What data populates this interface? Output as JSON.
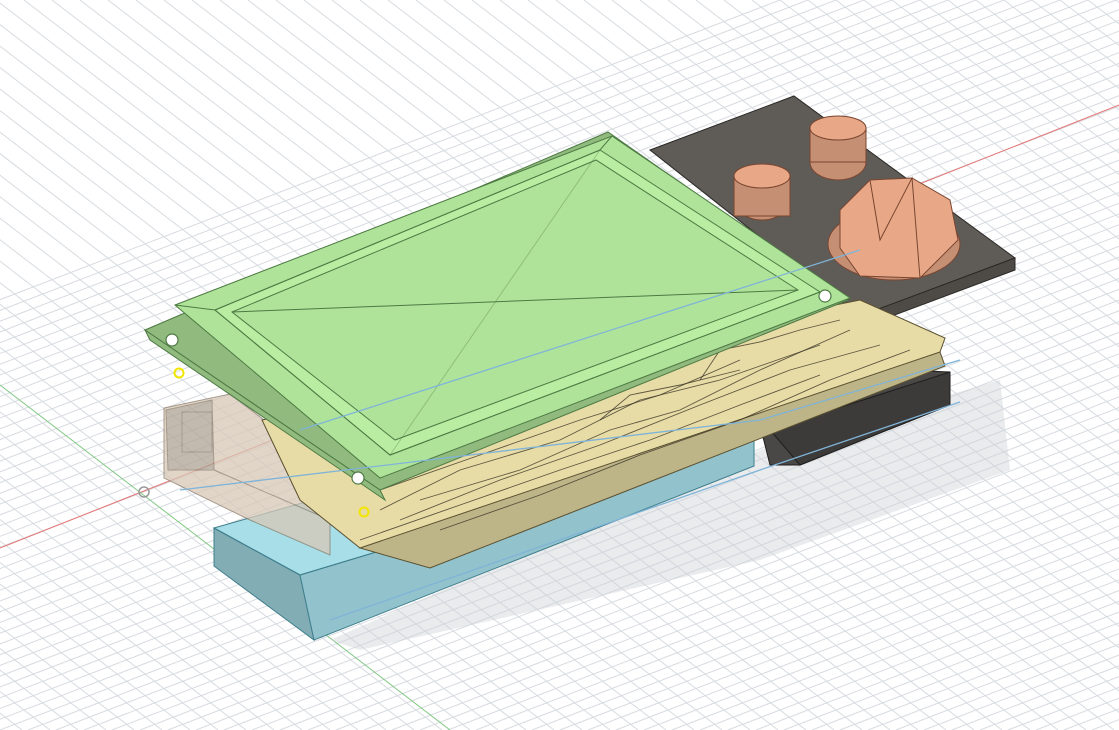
{
  "viewport": {
    "background": "#ffffff",
    "grid_color": "#d7dbe0",
    "x_axis_color": "#e57373",
    "y_axis_color": "#81c784",
    "guide_color": "#7fb4d8"
  },
  "components": {
    "lcd_bezel": {
      "color": "#b0e39a",
      "edge": "#4d7a43"
    },
    "pcb_board": {
      "color": "#e7dba6",
      "edge": "#5a5030"
    },
    "enclosure_base": {
      "color": "#9fd3dd",
      "edge": "#3f7f8d"
    },
    "connector_housing": {
      "color": "#d7c8b6",
      "edge": "#8a7a68"
    },
    "control_panel": {
      "color": "#5f5b57",
      "edge": "#2b2927"
    },
    "spacer_block": {
      "color": "#4a4847",
      "edge": "#1f1e1d"
    },
    "knobs": {
      "color": "#e8a888",
      "edge": "#7a4630",
      "count": 3
    }
  },
  "markers": {
    "color": "#f2e600",
    "count": 2
  }
}
